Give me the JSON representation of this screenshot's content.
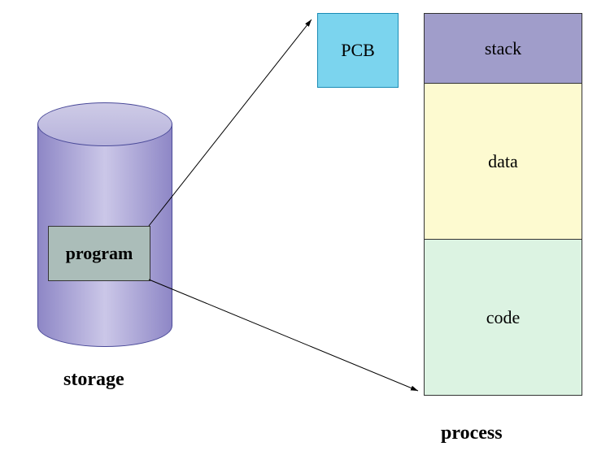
{
  "storage": {
    "label": "storage",
    "program_label": "program"
  },
  "pcb": {
    "label": "PCB"
  },
  "process": {
    "label": "process",
    "segments": {
      "stack": "stack",
      "data": "data",
      "code": "code"
    }
  }
}
